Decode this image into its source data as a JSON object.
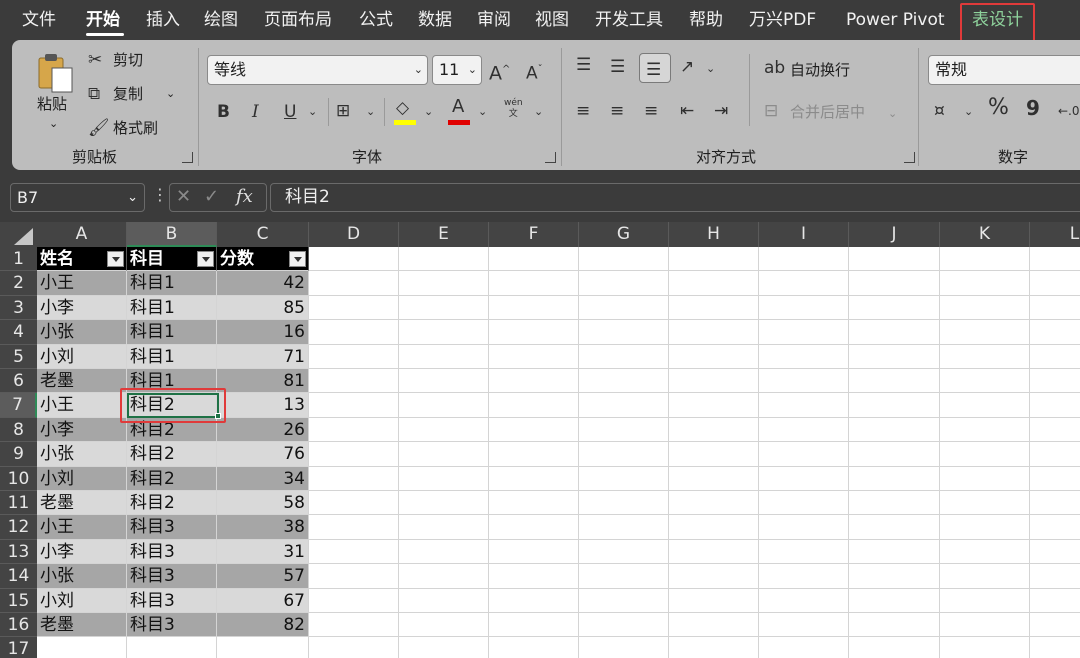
{
  "menu": {
    "items": [
      "文件",
      "开始",
      "插入",
      "绘图",
      "页面布局",
      "公式",
      "数据",
      "审阅",
      "视图",
      "开发工具",
      "帮助",
      "万兴PDF",
      "Power Pivot",
      "表设计"
    ],
    "active": "开始",
    "highlighted": "表设计"
  },
  "ribbon": {
    "clipboard": {
      "paste": "粘贴",
      "cut": "剪切",
      "copy": "复制",
      "format_painter": "格式刷",
      "group": "剪贴板"
    },
    "font": {
      "name": "等线",
      "size": "11",
      "bold": "B",
      "italic": "I",
      "underline": "U",
      "phonetic": "wén\n文",
      "group": "字体"
    },
    "align": {
      "wrap": "自动换行",
      "merge": "合并后居中",
      "group": "对齐方式"
    },
    "number": {
      "format": "常规",
      "percent": "%",
      "comma": "9",
      "group": "数字"
    },
    "colors": {
      "highlight": "#ffff00",
      "font_color": "#e00000"
    }
  },
  "formula_bar": {
    "name_box": "B7",
    "formula": "科目2",
    "fx": "fx"
  },
  "sheet": {
    "columns": [
      "A",
      "B",
      "C",
      "D",
      "E",
      "F",
      "G",
      "H",
      "I",
      "J",
      "K",
      "L"
    ],
    "rows": [
      "1",
      "2",
      "3",
      "4",
      "5",
      "6",
      "7",
      "8",
      "9",
      "10",
      "11",
      "12",
      "13",
      "14",
      "15",
      "16",
      "17"
    ],
    "selected_cell": "B7",
    "table_headers": [
      "姓名",
      "科目",
      "分数"
    ],
    "table_rows": [
      [
        "小王",
        "科目1",
        "42"
      ],
      [
        "小李",
        "科目1",
        "85"
      ],
      [
        "小张",
        "科目1",
        "16"
      ],
      [
        "小刘",
        "科目1",
        "71"
      ],
      [
        "老墨",
        "科目1",
        "81"
      ],
      [
        "小王",
        "科目2",
        "13"
      ],
      [
        "小李",
        "科目2",
        "26"
      ],
      [
        "小张",
        "科目2",
        "76"
      ],
      [
        "小刘",
        "科目2",
        "34"
      ],
      [
        "老墨",
        "科目2",
        "58"
      ],
      [
        "小王",
        "科目3",
        "38"
      ],
      [
        "小李",
        "科目3",
        "31"
      ],
      [
        "小张",
        "科目3",
        "57"
      ],
      [
        "小刘",
        "科目3",
        "67"
      ],
      [
        "老墨",
        "科目3",
        "82"
      ]
    ],
    "band_colors": {
      "dark": "#a6a6a6",
      "light": "#d9d9d9",
      "header": "#000000"
    }
  }
}
